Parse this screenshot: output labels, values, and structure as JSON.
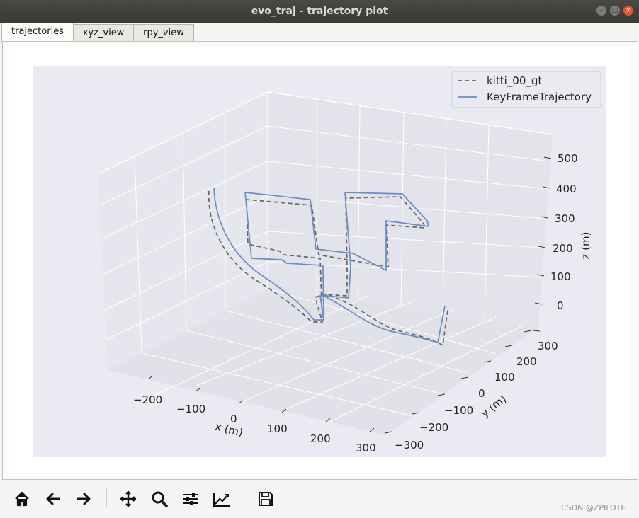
{
  "window": {
    "title": "evo_traj - trajectory plot"
  },
  "tabs": [
    {
      "label": "trajectories",
      "active": true
    },
    {
      "label": "xyz_view",
      "active": false
    },
    {
      "label": "rpy_view",
      "active": false
    }
  ],
  "toolbar": [
    {
      "name": "home",
      "icon": "home-icon"
    },
    {
      "name": "back",
      "icon": "arrow-left-icon"
    },
    {
      "name": "forward",
      "icon": "arrow-right-icon"
    },
    {
      "name": "pan",
      "icon": "move-icon"
    },
    {
      "name": "zoom",
      "icon": "magnifier-icon"
    },
    {
      "name": "subplots",
      "icon": "sliders-icon"
    },
    {
      "name": "axes",
      "icon": "chart-line-icon"
    },
    {
      "name": "save",
      "icon": "floppy-icon"
    }
  ],
  "watermark": "CSDN @ZPILOTE",
  "chart_data": {
    "type": "line",
    "projection": "3d",
    "xlabel": "x (m)",
    "ylabel": "y (m)",
    "zlabel": "z (m)",
    "x_ticks": [
      "−200",
      "−100",
      "0",
      "100",
      "200",
      "300"
    ],
    "y_ticks": [
      "−300",
      "−200",
      "−100",
      "0",
      "100",
      "200",
      "300"
    ],
    "z_ticks": [
      "0",
      "100",
      "200",
      "300",
      "400",
      "500"
    ],
    "legend_position": "top-right",
    "legend": [
      {
        "name": "kitti_00_gt",
        "style": "dashed",
        "color": "#666666"
      },
      {
        "name": "KeyFrameTrajectory",
        "style": "solid",
        "color": "#6a8cc4"
      }
    ],
    "series": [
      {
        "name": "kitti_00_gt",
        "color": "#666666",
        "dash": "6,4"
      },
      {
        "name": "KeyFrameTrajectory",
        "color": "#6a8cc4",
        "dash": ""
      }
    ],
    "background": "#eaeaf2",
    "grid": true
  }
}
